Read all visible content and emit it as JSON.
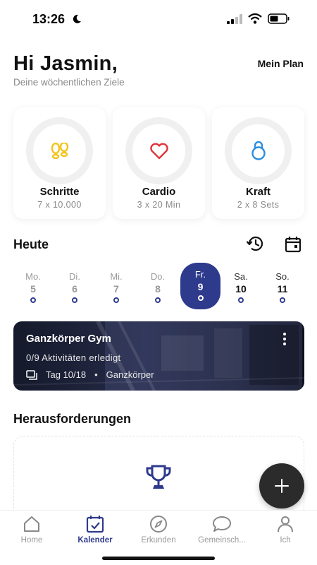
{
  "status_bar": {
    "time": "13:26"
  },
  "header": {
    "greeting": "Hi Jasmin,",
    "subtitle": "Deine wöchentlichen Ziele",
    "plan_link": "Mein Plan"
  },
  "goals": [
    {
      "title": "Schritte",
      "target": "7 x 10.000",
      "icon": "footsteps-icon",
      "color": "#f2c318",
      "progress": 0
    },
    {
      "title": "Cardio",
      "target": "3 x 20 Min",
      "icon": "heart-icon",
      "color": "#e0353b",
      "progress": 0
    },
    {
      "title": "Kraft",
      "target": "2 x 8 Sets",
      "icon": "kettlebell-icon",
      "color": "#2b8ee0",
      "progress": 0
    }
  ],
  "today": {
    "title": "Heute",
    "days": [
      {
        "label": "Mo.",
        "num": "5"
      },
      {
        "label": "Di.",
        "num": "6"
      },
      {
        "label": "Mi.",
        "num": "7"
      },
      {
        "label": "Do.",
        "num": "8"
      },
      {
        "label": "Fr.",
        "num": "9",
        "selected": true
      },
      {
        "label": "Sa.",
        "num": "10"
      },
      {
        "label": "So.",
        "num": "11"
      }
    ]
  },
  "workout": {
    "title": "Ganzkörper Gym",
    "progress": "0/9 Aktivitäten erledigt",
    "day": "Tag 10/18",
    "type": "Ganzkörper"
  },
  "challenges": {
    "title": "Herausforderungen"
  },
  "tabs": [
    {
      "label": "Home",
      "icon": "home-icon"
    },
    {
      "label": "Kalender",
      "icon": "calendar-check-icon",
      "active": true
    },
    {
      "label": "Erkunden",
      "icon": "compass-icon"
    },
    {
      "label": "Gemeinsch...",
      "icon": "chat-bubble-icon"
    },
    {
      "label": "Ich",
      "icon": "person-icon"
    }
  ],
  "colors": {
    "accent": "#2e3a8c",
    "fab": "#2b2b2b"
  }
}
